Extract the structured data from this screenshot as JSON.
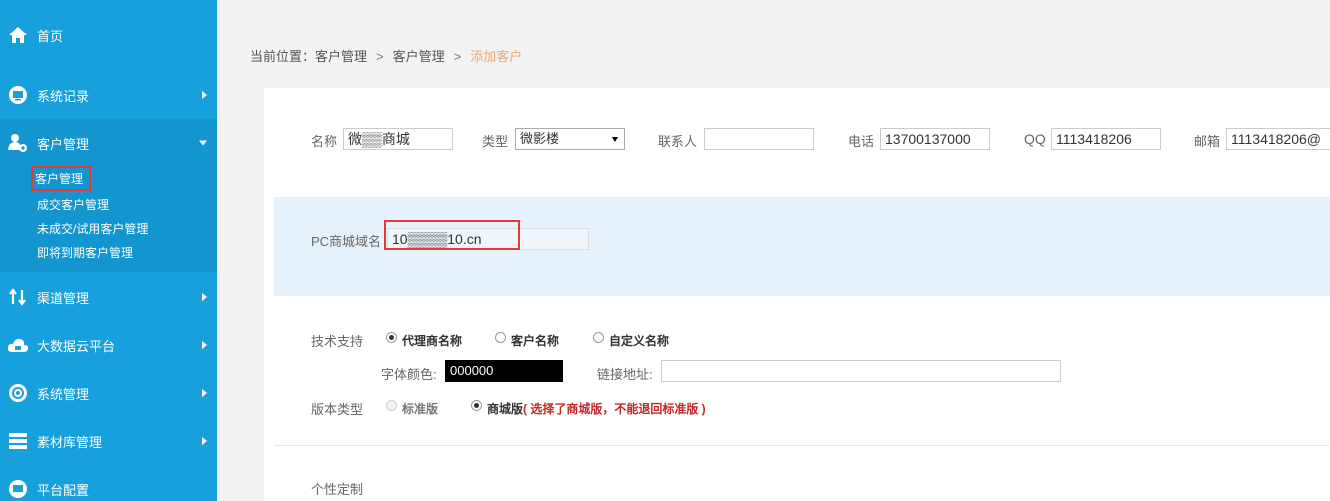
{
  "sidebar": {
    "items": [
      {
        "label": "首页",
        "icon": "home-icon"
      },
      {
        "label": "系统记录",
        "icon": "monitor-icon"
      },
      {
        "label": "客户管理",
        "icon": "user-gear-icon"
      },
      {
        "label": "渠道管理",
        "icon": "channel-arrows-icon"
      },
      {
        "label": "大数据云平台",
        "icon": "cloud-icon"
      },
      {
        "label": "系统管理",
        "icon": "gear-icon"
      },
      {
        "label": "素材库管理",
        "icon": "stack-icon"
      },
      {
        "label": "平台配置",
        "icon": "platform-icon"
      }
    ],
    "sub_items": [
      "客户管理",
      "成交客户管理",
      "未成交/试用客户管理",
      "即将到期客户管理"
    ]
  },
  "breadcrumb": {
    "prefix": "当前位置：",
    "crumbs": [
      "客户管理",
      "客户管理",
      "添加客户"
    ],
    "sep": ">"
  },
  "form": {
    "name_label": "名称",
    "name_value": "微▒▒商城",
    "type_label": "类型",
    "type_value": "微影楼",
    "contact_label": "联系人",
    "contact_value": "",
    "phone_label": "电话",
    "phone_value": "13700137000",
    "qq_label": "QQ",
    "qq_value": "1113418206",
    "email_label": "邮箱",
    "email_value": "1113418206@",
    "domain_label": "PC商城域名",
    "domain_value": "10▒▒▒▒10.cn",
    "support_label": "技术支持",
    "support_options": [
      "代理商名称",
      "客户名称",
      "自定义名称"
    ],
    "font_color_label": "字体颜色:",
    "font_color_value": "000000",
    "link_label": "链接地址:",
    "link_value": "",
    "version_label": "版本类型",
    "version_options": [
      "标准版",
      "商城版"
    ],
    "version_warning": "( 选择了商城版，不能退回标准版 )",
    "custom_label": "个性定制"
  },
  "colors": {
    "sidebar": "#18a0dc",
    "highlight": "#e53935",
    "crumb_current": "#f0a86a"
  }
}
